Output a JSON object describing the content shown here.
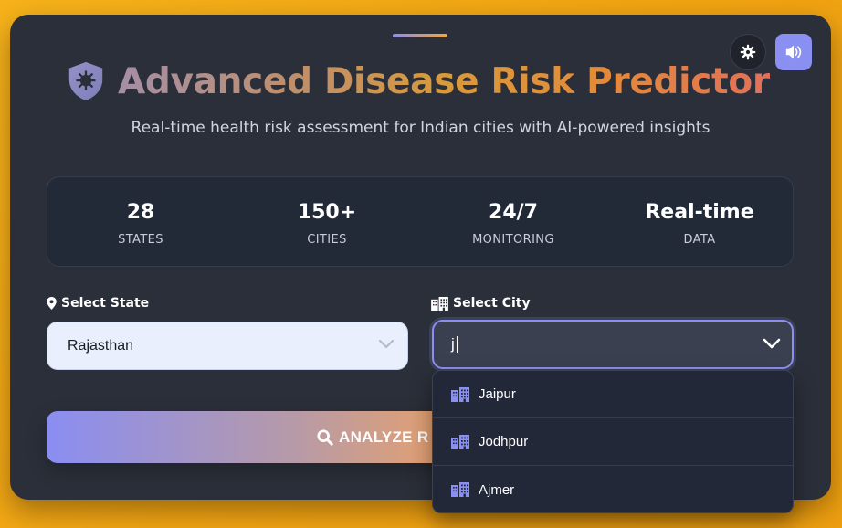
{
  "header": {
    "title": "Advanced Disease Risk Predictor",
    "subtitle": "Real-time health risk assessment for Indian cities with AI-powered insights"
  },
  "controls": {
    "theme_icon": "gear-icon",
    "sound_icon": "volume-icon"
  },
  "stats": [
    {
      "value": "28",
      "label": "STATES"
    },
    {
      "value": "150+",
      "label": "CITIES"
    },
    {
      "value": "24/7",
      "label": "MONITORING"
    },
    {
      "value": "Real-time",
      "label": "DATA"
    }
  ],
  "form": {
    "state_label": "Select State",
    "state_value": "Rajasthan",
    "city_label": "Select City",
    "city_value": "j"
  },
  "analyze_button": {
    "label": "ANALYZE R"
  },
  "city_dropdown": {
    "options": [
      "Jaipur",
      "Jodhpur",
      "Ajmer"
    ]
  },
  "colors": {
    "accent": "#8a8ff2",
    "card_bg": "#2b2f39",
    "page_bg": "#f6b21a"
  }
}
